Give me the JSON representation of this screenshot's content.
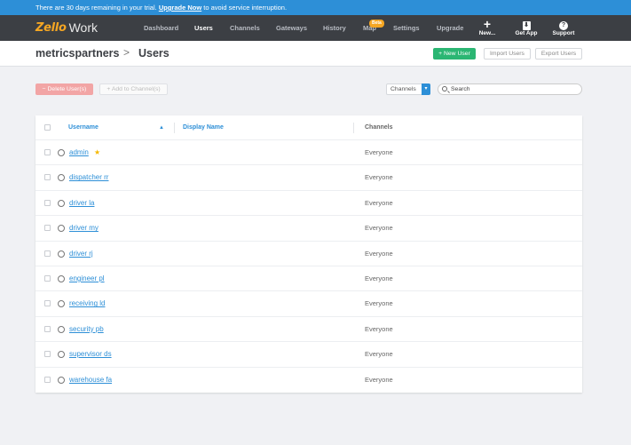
{
  "trial": {
    "prefix": "There are 30 days remaining in your trial. ",
    "link": "Upgrade Now",
    "suffix": " to avoid service interruption."
  },
  "brand": {
    "logo_main": "Zello",
    "logo_sub": "Work"
  },
  "nav": {
    "dashboard": "Dashboard",
    "users": "Users",
    "channels": "Channels",
    "gateways": "Gateways",
    "history": "History",
    "map": "Map",
    "map_badge": "Beta",
    "settings": "Settings",
    "upgrade": "Upgrade",
    "new_label": "New...",
    "new_icon": "+",
    "getapp_label": "Get App",
    "getapp_icon": "⬇",
    "support_label": "Support",
    "support_icon": "?"
  },
  "header": {
    "org": "metricspartners",
    "separator": ">",
    "page_title": "Users",
    "new_user": "+ New User",
    "import_users": "Import Users",
    "export_users": "Export Users"
  },
  "toolbar": {
    "delete_users": "− Delete User(s)",
    "add_to_channels": "+ Add to Channel(s)",
    "filter_value": "Channels",
    "filter_arrow": "▾",
    "search_placeholder": "Search"
  },
  "table": {
    "col_username": "Username",
    "sort_indicator": "▲",
    "col_display_name": "Display Name",
    "col_channels": "Channels",
    "rows": [
      {
        "username": "admin",
        "star": "★",
        "channels": "Everyone"
      },
      {
        "username": "dispatcher rr",
        "channels": "Everyone"
      },
      {
        "username": "driver la",
        "channels": "Everyone"
      },
      {
        "username": "driver my",
        "channels": "Everyone"
      },
      {
        "username": "driver rj",
        "channels": "Everyone"
      },
      {
        "username": "engineer pl",
        "channels": "Everyone"
      },
      {
        "username": "receiving ld",
        "channels": "Everyone"
      },
      {
        "username": "security pb",
        "channels": "Everyone"
      },
      {
        "username": "supervisor ds",
        "channels": "Everyone"
      },
      {
        "username": "warehouse fa",
        "channels": "Everyone"
      }
    ]
  },
  "colors": {
    "trial_bar": "#2d8fd7",
    "navbar": "#3c3f44",
    "accent": "#2d8fd7",
    "green": "#2bb673",
    "delete_red": "#f2a5a5",
    "logo_orange": "#f5a623"
  }
}
